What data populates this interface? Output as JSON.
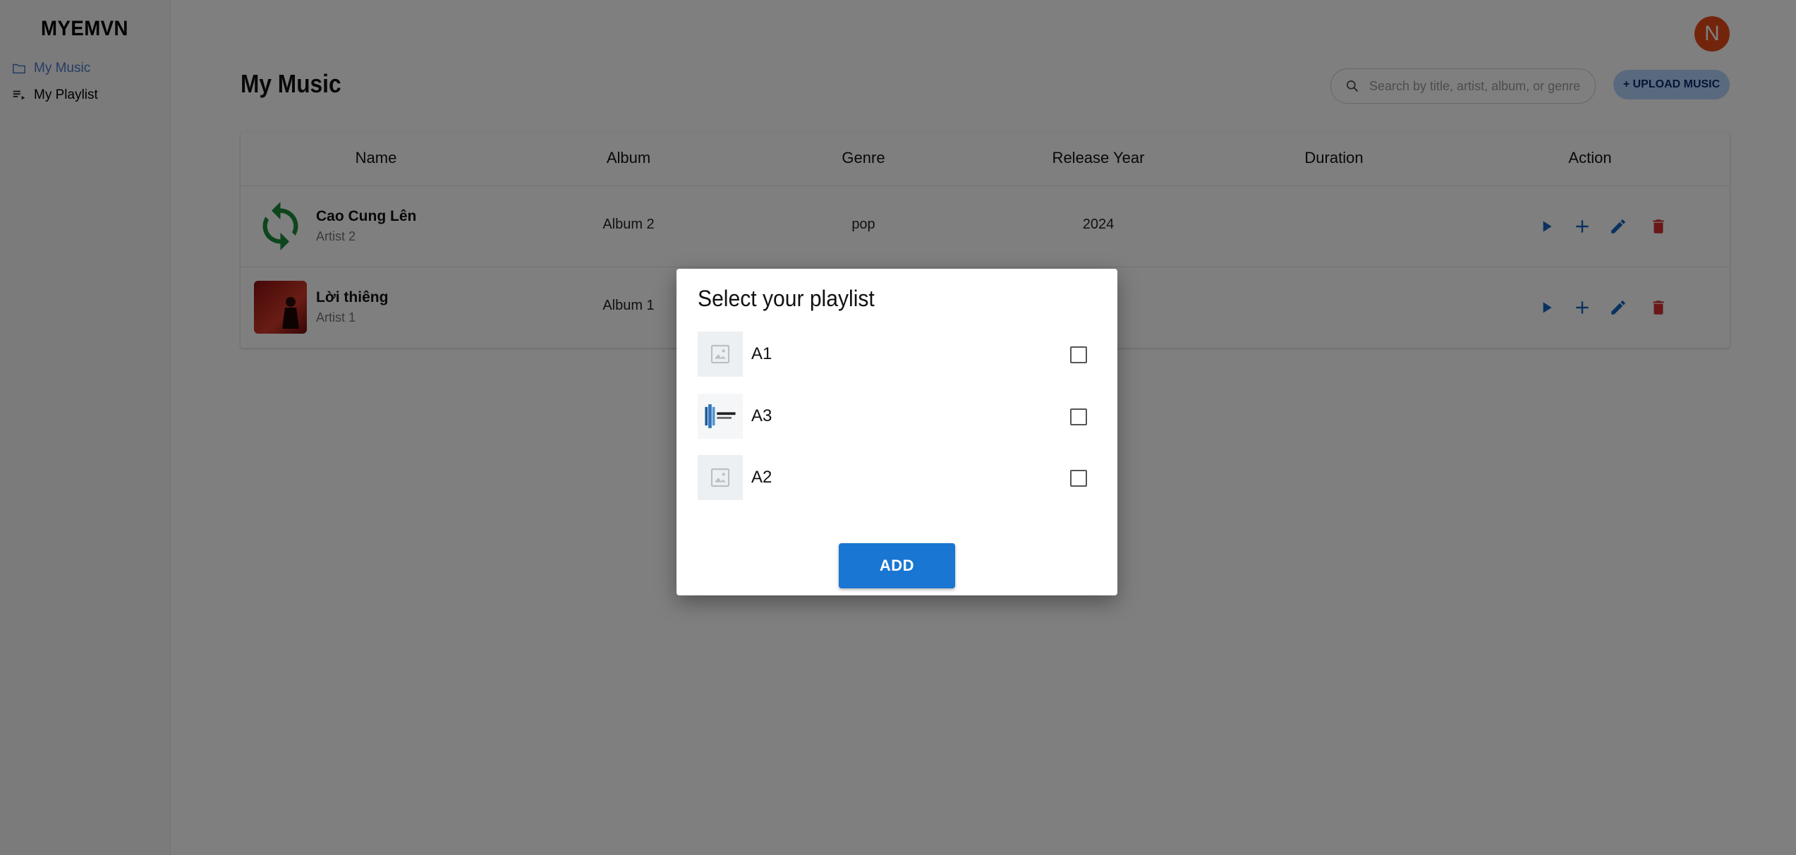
{
  "app": {
    "logo": "MYEMVN"
  },
  "sidebar": {
    "items": [
      {
        "label": "My Music",
        "icon": "folder-icon",
        "active": true
      },
      {
        "label": "My Playlist",
        "icon": "playlist-icon",
        "active": false
      }
    ]
  },
  "header": {
    "title": "My Music",
    "search_placeholder": "Search by title, artist, album, or genre",
    "upload_label": "+ UPLOAD MUSIC",
    "avatar_initial": "N"
  },
  "table": {
    "columns": [
      "Name",
      "Album",
      "Genre",
      "Release Year",
      "Duration",
      "Action"
    ],
    "rows": [
      {
        "name": "Cao Cung Lên",
        "artist": "Artist 2",
        "album": "Album 2",
        "genre": "pop",
        "year": "2024",
        "duration": "",
        "thumb": "refresh-icon"
      },
      {
        "name": "Lời thiêng",
        "artist": "Artist 1",
        "album": "Album 1",
        "genre": "",
        "year": "",
        "duration": "",
        "thumb": "album-cover-image"
      }
    ]
  },
  "dialog": {
    "title": "Select your playlist",
    "playlists": [
      {
        "name": "A1",
        "thumb": "image-placeholder-icon",
        "checked": false
      },
      {
        "name": "A3",
        "thumb": "amazon-redshift-logo",
        "checked": false
      },
      {
        "name": "A2",
        "thumb": "image-placeholder-icon",
        "checked": false
      }
    ],
    "add_label": "ADD"
  },
  "colors": {
    "accent": "#1976d2",
    "upload_bg": "#b3d4ff",
    "avatar": "#e64a19",
    "delete": "#d32f2f",
    "nav_active": "#4a79c8"
  }
}
